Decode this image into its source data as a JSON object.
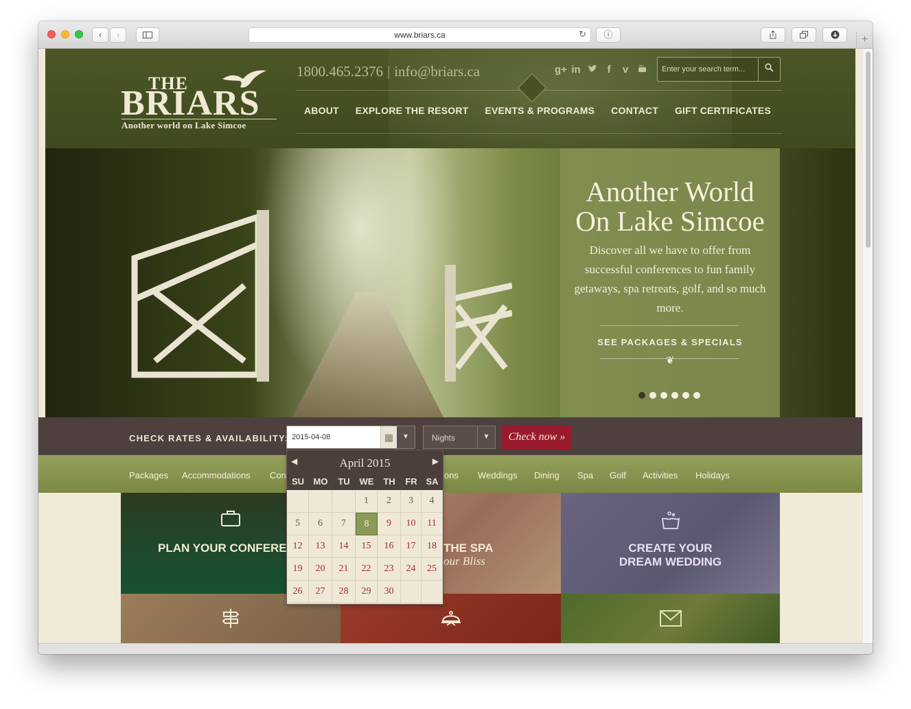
{
  "browser": {
    "url": "www.briars.ca"
  },
  "header": {
    "logo_the": "THE",
    "logo_main": "BRIARS",
    "logo_tagline": "Another world on Lake Simcoe",
    "phone": "1800.465.2376",
    "separator": "|",
    "email": "info@briars.ca",
    "social": [
      "google-plus",
      "linkedin",
      "twitter",
      "facebook",
      "vimeo",
      "youtube"
    ],
    "search_placeholder": "Enter your search term...",
    "nav": [
      "ABOUT",
      "EXPLORE THE RESORT",
      "EVENTS & PROGRAMS",
      "CONTACT",
      "GIFT CERTIFICATES"
    ]
  },
  "hero": {
    "title_line1": "Another World",
    "title_line2": "On Lake Simcoe",
    "text": "Discover all we have to offer from successful conferences to fun family getaways, spa retreats, golf, and so much more.",
    "link": "SEE PACKAGES & SPECIALS",
    "slide_count": 6,
    "active_slide": 1
  },
  "availability": {
    "label": "CHECK RATES & AVAILABILITY:",
    "date_value": "2015-04-08",
    "nights_placeholder": "Nights",
    "check_button": "Check now »"
  },
  "categories": [
    "Packages",
    "Accommodations",
    "Con",
    "ions",
    "Weddings",
    "Dining",
    "Spa",
    "Golf",
    "Activities",
    "Holidays"
  ],
  "tiles": {
    "conference": "PLAN YOUR CONFEREN",
    "spa_title": "THE SPA",
    "spa_sub": "our Bliss",
    "wedding_line1": "CREATE YOUR",
    "wedding_line2": "DREAM WEDDING"
  },
  "datepicker": {
    "month_title": "April 2015",
    "dows": [
      "SU",
      "MO",
      "TU",
      "WE",
      "TH",
      "FR",
      "SA"
    ],
    "weeks": [
      [
        "",
        "",
        "",
        "1",
        "2",
        "3",
        "4"
      ],
      [
        "5",
        "6",
        "7",
        "8",
        "9",
        "10",
        "11"
      ],
      [
        "12",
        "13",
        "14",
        "15",
        "16",
        "17",
        "18"
      ],
      [
        "19",
        "20",
        "21",
        "22",
        "23",
        "24",
        "25"
      ],
      [
        "26",
        "27",
        "28",
        "29",
        "30",
        "",
        ""
      ]
    ],
    "selected_day": "8",
    "past_days": [
      "1",
      "2",
      "3",
      "4",
      "5",
      "6",
      "7"
    ]
  },
  "colors": {
    "header_green": "#46521f",
    "accent_red": "#9a1b2d",
    "availability_bar": "#4d403e",
    "category_green": "#8a9752",
    "panel_green": "#849052"
  }
}
